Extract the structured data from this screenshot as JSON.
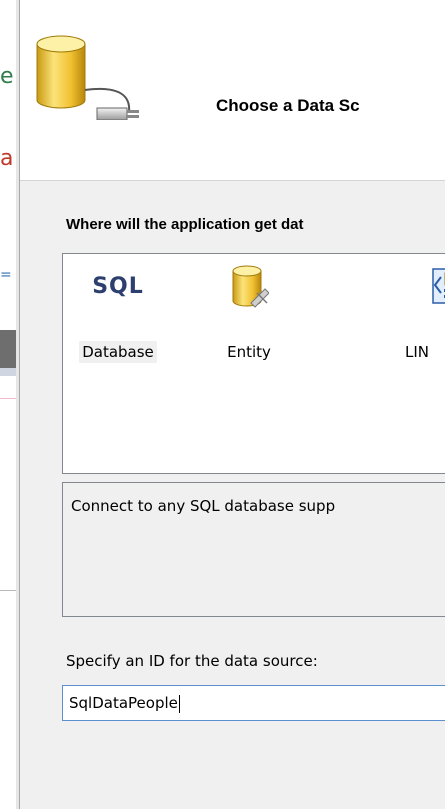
{
  "background_window": {
    "fragments": [
      "e",
      "a",
      "="
    ]
  },
  "dialog": {
    "title": "Choose a Data Sc",
    "question": "Where will the application get dat",
    "data_source_types": [
      {
        "label": "Database",
        "icon": "sql-database-icon",
        "glyph": "SQL",
        "selected": true
      },
      {
        "label": "Entity",
        "icon": "entity-database-icon",
        "selected": false
      },
      {
        "label": "LIN",
        "icon": "linq-icon",
        "selected": false
      }
    ],
    "description": "Connect to any SQL database supp",
    "id_label": "Specify an ID for the data source:",
    "id_value": "SqlDataPeople"
  },
  "colors": {
    "dialog_bg": "#f0f0f0",
    "input_focus_border": "#5a8fd0",
    "list_border": "#828790"
  }
}
